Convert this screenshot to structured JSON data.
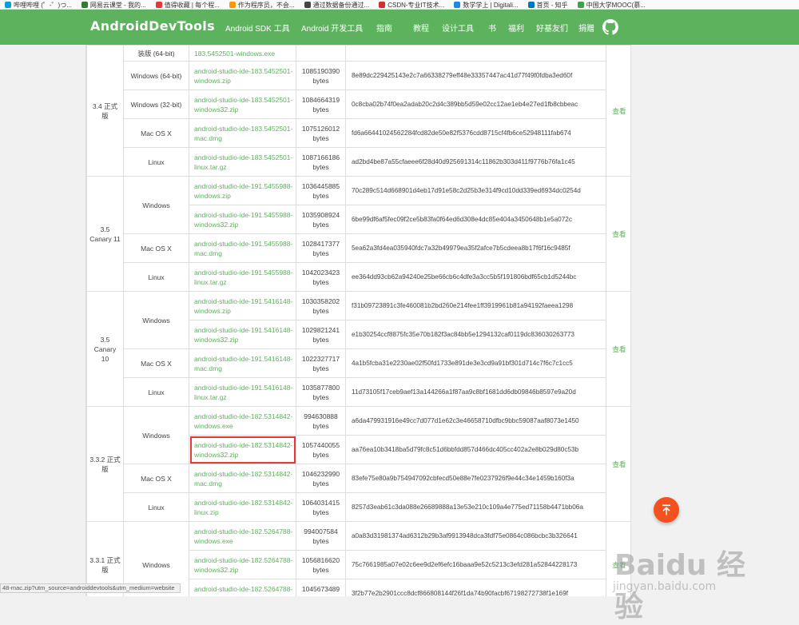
{
  "bookmarks": [
    {
      "label": "哔哩哔哩 (゜-゜)つ...",
      "color": "#00a1d6"
    },
    {
      "label": "网易云课堂 - 我的...",
      "color": "#2e7d32"
    },
    {
      "label": "值得收藏 | 每个程...",
      "color": "#e53935"
    },
    {
      "label": "作为程序员，不会...",
      "color": "#ff9800"
    },
    {
      "label": "通过数据备份通过...",
      "color": "#444444"
    },
    {
      "label": "CSDN-专业IT技术...",
      "color": "#d32f2f"
    },
    {
      "label": "数学学上 | Digitali...",
      "color": "#1e88e5"
    },
    {
      "label": "首页 - 知乎",
      "color": "#0277bd"
    },
    {
      "label": "中国大学MOOC(慕...",
      "color": "#43a047"
    }
  ],
  "brand": {
    "name": "AndroidDevTools",
    "accent": "#5cb25d"
  },
  "nav": [
    "Android SDK 工具",
    "Android 开发工具",
    "指南",
    "教程",
    "设计工具",
    "书",
    "福利",
    "好基友们",
    "捐赠"
  ],
  "view_label": "查看",
  "groups": [
    {
      "version": "3.4 正式版",
      "rows": [
        {
          "platform": "装版 (64-bit)",
          "file": "183.5452501-windows.exe",
          "size": "",
          "unit": "",
          "sha": "",
          "partial": true
        },
        {
          "platform": "Windows (64-bit)",
          "file": "android-studio-ide-183.5452501-windows.zip",
          "size": "1085190390",
          "unit": "bytes",
          "sha": "8e89dc229425143e2c7a66338279eff48e33357447ac41d77f49f0fdba3ed60f"
        },
        {
          "platform": "Windows (32-bit)",
          "file": "android-studio-ide-183.5452501-windows32.zip",
          "size": "1084664319",
          "unit": "bytes",
          "sha": "0c8cba02b74f0ea2adab20c2d4c389bb5d59e02cc12ae1eb4e27ed1fb8cbbeac"
        },
        {
          "platform": "Mac OS X",
          "file": "android-studio-ide-183.5452501-mac.dmg",
          "size": "1075126012",
          "unit": "bytes",
          "sha": "fd6a66441024562284fcd82de50e82f5376cdd8715cf4fb6ce52948111fab674"
        },
        {
          "platform": "Linux",
          "file": "android-studio-ide-183.5452501-linux.tar.gz",
          "size": "1087166186",
          "unit": "bytes",
          "sha": "ad2bd4be87a55cfaeee6f28d40d925691314c11862b303d411f9776b76fa1c45"
        }
      ]
    },
    {
      "version": "3.5 Canary 11",
      "rows": [
        {
          "platform": "Windows",
          "file": "android-studio-ide-191.5455988-windows.zip",
          "size": "1036445885",
          "unit": "bytes",
          "sha": "70c289c514d668901d4eb17d91e58c2d25b3e314f9cd10dd339ed6934dc0254d"
        },
        {
          "platform": "",
          "file": "android-studio-ide-191.5455988-windows32.zip",
          "size": "1035908924",
          "unit": "bytes",
          "sha": "6be99df6af5fec09f2ce5b83fa0f64ed6d308e4dc85e404a3450648b1e5a072c"
        },
        {
          "platform": "Mac OS X",
          "file": "android-studio-ide-191.5455988-mac.dmg",
          "size": "1028417377",
          "unit": "bytes",
          "sha": "5ea62a3fd4ea035940fdc7a32b49979ea35f2afce7b5cdeea8b17f6f16c9485f"
        },
        {
          "platform": "Linux",
          "file": "android-studio-ide-191.5455988-linux.tar.gz",
          "size": "1042023423",
          "unit": "bytes",
          "sha": "ee364dd93cb62a94240e25be66cb6c4dfe3a3cc5b5f191806bdf65cb1d5244bc"
        }
      ]
    },
    {
      "version": "3.5 Canary 10",
      "rows": [
        {
          "platform": "Windows",
          "file": "android-studio-ide-191.5416148-windows.zip",
          "size": "1030358202",
          "unit": "bytes",
          "sha": "f31b09723891c3fe460081b2bd260e214fee1ff3919961b81a94192faeea1298"
        },
        {
          "platform": "",
          "file": "android-studio-ide-191.5416148-windows32.zip",
          "size": "1029821241",
          "unit": "bytes",
          "sha": "e1b30254ccf8875fc35e70b182f3ac84bb5e1294132caf0119dc836030263773"
        },
        {
          "platform": "Mac OS X",
          "file": "android-studio-ide-191.5416148-mac.dmg",
          "size": "1022327717",
          "unit": "bytes",
          "sha": "4a1b5fcba31e2230ae02f50fd1733e891de3e3cd9a91bf301d714c7f6c7c1cc5"
        },
        {
          "platform": "Linux",
          "file": "android-studio-ide-191.5416148-linux.tar.gz",
          "size": "1035877800",
          "unit": "bytes",
          "sha": "11d73105f17ceb9aef13a144266a1f87aa9c8bf1681dd6db09846b8597e9a20d"
        }
      ]
    },
    {
      "version": "3.3.2 正式版",
      "rows": [
        {
          "platform": "Windows",
          "file": "android-studio-ide-182.5314842-windows.exe",
          "size": "994630888",
          "unit": "bytes",
          "sha": "a6da479931916e49cc7d077d1e62c3e46658710dfbc9bbc59087aaf8073e1450"
        },
        {
          "platform": "",
          "file": "android-studio-ide-182.5314842-windows32.zip",
          "size": "1057440055",
          "unit": "bytes",
          "sha": "aa76ea10b3418ba5d79fc8c51d6bbfdd857d466dc405cc402a2e8b029d80c53b",
          "highlight": true
        },
        {
          "platform": "Mac OS X",
          "file": "android-studio-ide-182.5314842-mac.dmg",
          "size": "1046232990",
          "unit": "bytes",
          "sha": "83efe75e80a9b754947092cbfecd50e88e7fe0237926f9e44c34e1459b160f3a"
        },
        {
          "platform": "Linux",
          "file": "android-studio-ide-182.5314842-linux.zip",
          "size": "1064031415",
          "unit": "bytes",
          "sha": "8257d3eab61c3da088e26689888a13e53e210c109a4e775ed71158b4471bb06a"
        }
      ]
    },
    {
      "version": "3.3.1 正式版",
      "rows": [
        {
          "platform": "Windows",
          "file": "android-studio-ide-182.5264788-windows.exe",
          "size": "994007584",
          "unit": "bytes",
          "sha": "a0a83d31981374ad6312b29b3af9913948dca3fdf75e0864c086bcbc3b326641"
        },
        {
          "platform": "",
          "file": "android-studio-ide-182.5264788-windows32.zip",
          "size": "1056816620",
          "unit": "bytes",
          "sha": "75c7661985a07e02c6ee9d2ef6efc16baaa9e52c5213c3efd281a52844228173"
        },
        {
          "platform": "",
          "file": "android-studio-ide-182.5264788-mac.dmg",
          "size": "1045673489",
          "unit": "bytes",
          "sha": "3f2b77e2b2901ccc8dcf866808144f26f1da74b90facbf67198272738f1e169f"
        }
      ]
    }
  ],
  "status_url": "48-mac.zip?utm_source=androiddevtools&utm_medium=website",
  "watermark": {
    "big": "Baidu 经验",
    "small": "jingyan.baidu.com"
  }
}
